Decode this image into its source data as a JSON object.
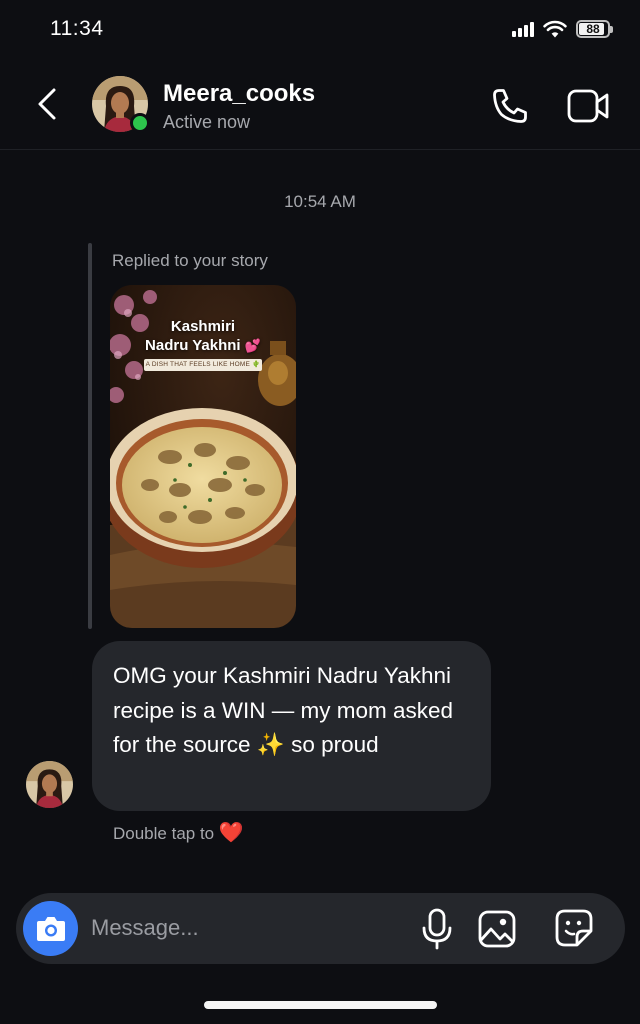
{
  "status_bar": {
    "time": "11:34",
    "battery": "88"
  },
  "header": {
    "username": "Meera_cooks",
    "status": "Active now"
  },
  "chat": {
    "timestamp": "10:54 AM",
    "story_reply_label": "Replied to your story",
    "story": {
      "title_line1": "Kashmiri",
      "title_line2": "Nadru Yakhni",
      "title_emoji": "💕",
      "subtitle": "A DISH THAT FEELS LIKE HOME 🌵"
    },
    "message": "OMG your Kashmiri Nadru Yakhni recipe is a WIN — my mom asked for the source ✨ so proud",
    "double_tap_hint": "Double tap to",
    "double_tap_emoji": "❤️"
  },
  "composer": {
    "placeholder": "Message..."
  },
  "colors": {
    "background": "#0d0e12",
    "bubble": "#25272c",
    "accent_blue": "#3a7cf5",
    "online_green": "#2dc44c",
    "secondary_text": "#a6a8ad"
  },
  "icons": {
    "back": "chevron-left-icon",
    "call": "phone-icon",
    "video": "video-camera-icon",
    "camera": "camera-icon",
    "mic": "microphone-icon",
    "gallery": "image-icon",
    "sticker": "sticker-icon"
  }
}
